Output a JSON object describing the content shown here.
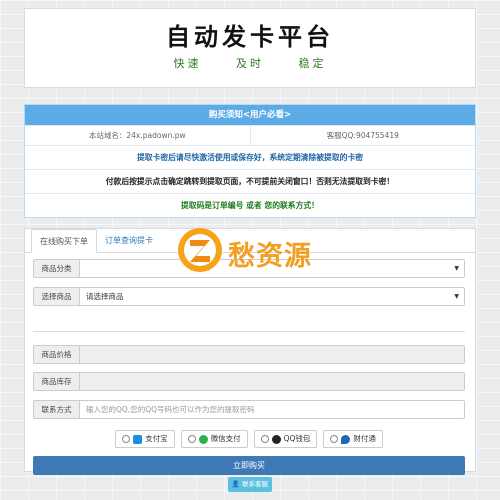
{
  "header": {
    "title": "自动发卡平台",
    "slogan": [
      "快速",
      "及时",
      "稳定"
    ]
  },
  "notice": {
    "heading": "购买须知<用户必看>",
    "domain": "本站域名：24x.padown.pw",
    "service_qq": "客服QQ:904755419",
    "lines": [
      "提取卡密后请尽快激活使用或保存好，系统定期清除被提取的卡密",
      "付款后按提示点击确定跳转到提取页面，不可提前关闭窗口！否则无法提取到卡密！",
      "提取码是订单编号 或者 您的联系方式！"
    ]
  },
  "tabs": [
    "在线购买下单",
    "订单查询提卡"
  ],
  "form": {
    "category": {
      "label": "商品分类",
      "value": ""
    },
    "product": {
      "label": "选择商品",
      "value": "请选择商品"
    },
    "price": {
      "label": "商品价格",
      "value": ""
    },
    "stock": {
      "label": "商品库存",
      "value": ""
    },
    "contact": {
      "label": "联系方式",
      "placeholder": "输入您的QQ,您的QQ号码也可以作为您的提取密码"
    }
  },
  "payments": [
    "支付宝",
    "微信支付",
    "QQ钱包",
    "财付通"
  ],
  "buy_label": "立即购买",
  "contact_service_label": "联系客服",
  "watermark": "愁资源",
  "colors": {
    "notice_header": "#5aabe6",
    "buy_button": "#3f79b5",
    "contact_button": "#5bc0de",
    "watermark": "#f29a17"
  }
}
